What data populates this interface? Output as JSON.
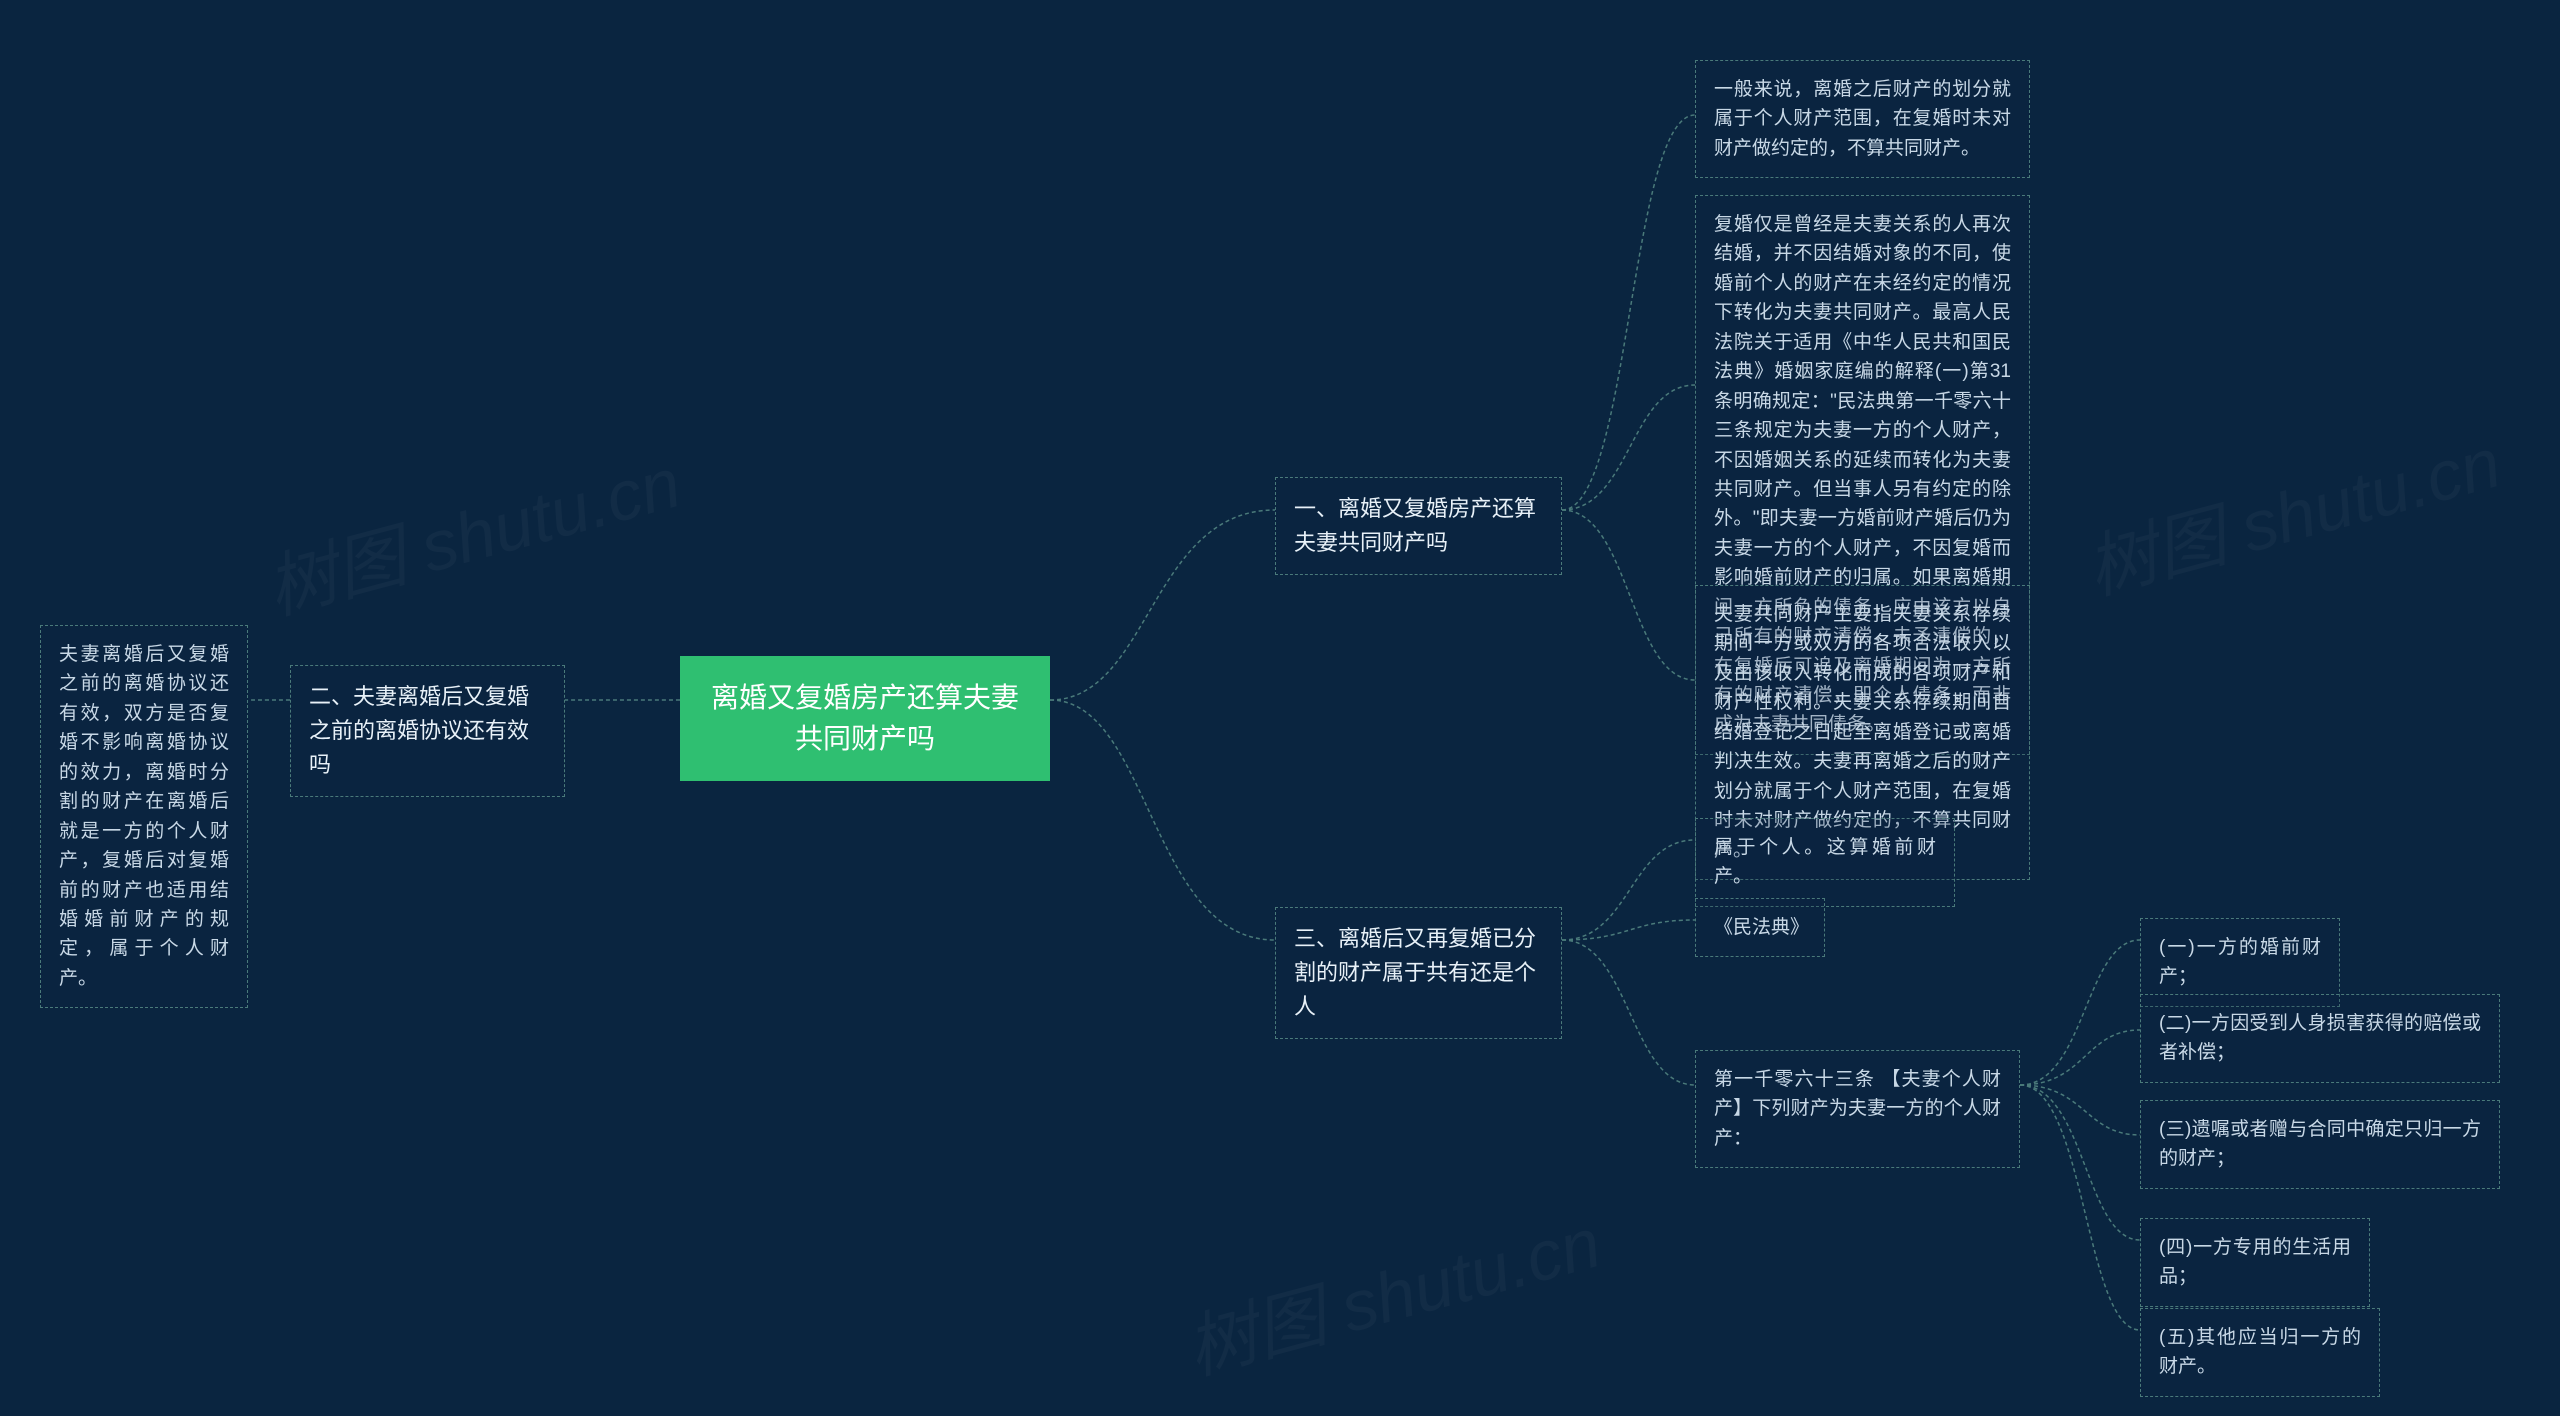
{
  "watermark": "树图 shutu.cn",
  "root": {
    "title": "离婚又复婚房产还算夫妻共同财产吗"
  },
  "branches": {
    "b1": {
      "title": "一、离婚又复婚房产还算夫妻共同财产吗",
      "leaves": {
        "l1": "一般来说，离婚之后财产的划分就属于个人财产范围，在复婚时未对财产做约定的，不算共同财产。",
        "l2": "复婚仅是曾经是夫妻关系的人再次结婚，并不因结婚对象的不同，使婚前个人的财产在未经约定的情况下转化为夫妻共同财产。最高人民法院关于适用《中华人民共和国民法典》婚姻家庭编的解释(一)第31条明确规定：\"民法典第一千零六十三条规定为夫妻一方的个人财产，不因婚姻关系的延续而转化为夫妻共同财产。但当事人另有约定的除外。\"即夫妻一方婚前财产婚后仍为夫妻一方的个人财产，不因复婚而影响婚前财产的归属。如果离婚期间一方所负的债务，应由该方以自己所有的财产清偿，未予清偿的，在复婚后可追及离婚期间为一方所有的财产清偿，即个人债务，而非成为夫妻共同债务。",
        "l3": "夫妻共同财产主要指夫妻关系存续期间一方或双方的各项合法收入以及由该收入转化而成的各项财产和财产性权利。夫妻关系存续期间自结婚登记之日起至离婚登记或离婚判决生效。夫妻再离婚之后的财产划分就属于个人财产范围，在复婚时未对财产做约定的，不算共同财产。"
      }
    },
    "b2": {
      "title": "二、夫妻离婚后又复婚之前的离婚协议还有效吗",
      "leaves": {
        "l1": "夫妻离婚后又复婚之前的离婚协议还有效，双方是否复婚不影响离婚协议的效力，离婚时分割的财产在离婚后就是一方的个人财产，复婚后对复婚前的财产也适用结婚婚前财产的规定，属于个人财产。"
      }
    },
    "b3": {
      "title": "三、离婚后又再复婚已分割的财产属于共有还是个人",
      "leaves": {
        "l1": "属于个人。这算婚前财产。",
        "l2": "《民法典》",
        "l3": {
          "label": "第一千零六十三条 【夫妻个人财产】下列财产为夫妻一方的个人财产：",
          "items": {
            "i1": "(一)一方的婚前财产；",
            "i2": "(二)一方因受到人身损害获得的赔偿或者补偿；",
            "i3": "(三)遗嘱或者赠与合同中确定只归一方的财产；",
            "i4": "(四)一方专用的生活用品；",
            "i5": "(五)其他应当归一方的财产。"
          }
        }
      }
    }
  }
}
